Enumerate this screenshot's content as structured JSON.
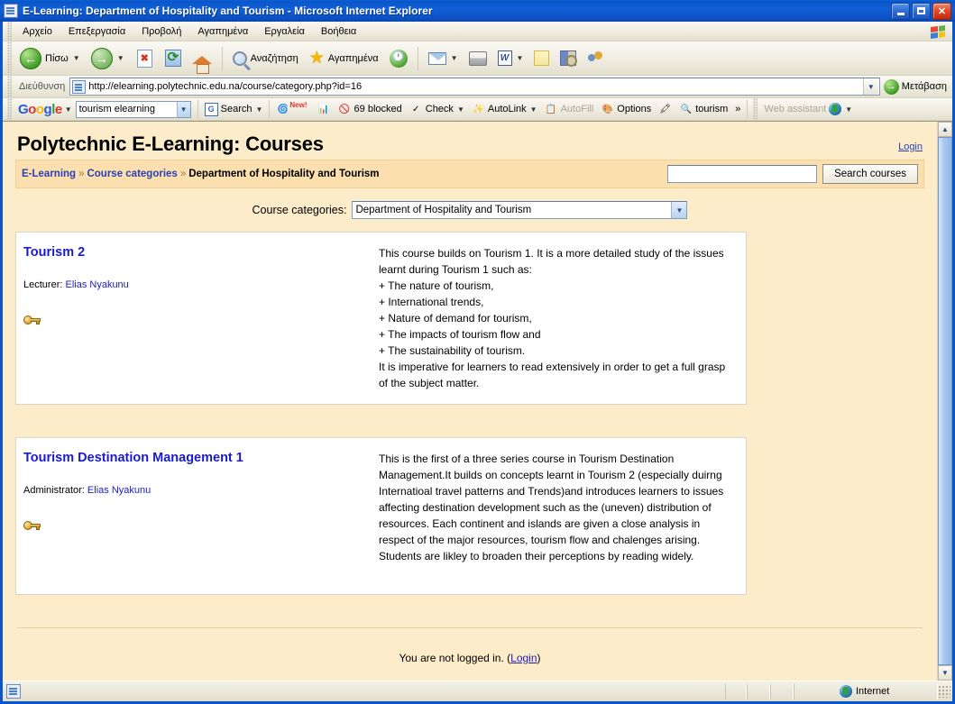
{
  "window": {
    "title": "E-Learning: Department of Hospitality and Tourism - Microsoft Internet Explorer",
    "minimize_label": "",
    "maximize_label": "",
    "close_label": "✕"
  },
  "menubar": {
    "items": [
      {
        "label": "Αρχείο"
      },
      {
        "label": "Επεξεργασία"
      },
      {
        "label": "Προβολή"
      },
      {
        "label": "Αγαπημένα"
      },
      {
        "label": "Εργαλεία"
      },
      {
        "label": "Βοήθεια"
      }
    ]
  },
  "toolbar": {
    "back_label": "Πίσω",
    "forward_label": "",
    "stop_label": "",
    "refresh_label": "",
    "home_label": "",
    "search_label": "Αναζήτηση",
    "favorites_label": "Αγαπημένα",
    "history_label": "",
    "mail_label": "",
    "print_label": "",
    "edit_word_label": "",
    "notes_label": "",
    "research_label": "",
    "messenger_label": ""
  },
  "addressbar": {
    "label": "Διεύθυνση",
    "url": "http://elearning.polytechnic.edu.na/course/category.php?id=16",
    "go_label": "Μετάβαση"
  },
  "google_toolbar": {
    "logo": "Google",
    "query": "tourism elearning",
    "search_label": "Search",
    "new_badge": "New!",
    "blocked_label": "69 blocked",
    "check_label": "Check",
    "autolink_label": "AutoLink",
    "autofill_label": "AutoFill",
    "options_label": "Options",
    "highlight_term": "tourism",
    "more_label": "»",
    "web_assistant_label": "Web assistant"
  },
  "page": {
    "site_title": "Polytechnic E-Learning: Courses",
    "login_link": "Login",
    "breadcrumb": {
      "items": [
        {
          "label": "E-Learning",
          "link": true
        },
        {
          "label": "Course categories",
          "link": true
        },
        {
          "label": "Department of Hospitality and Tourism",
          "link": false
        }
      ],
      "separator": "»"
    },
    "course_search": {
      "value": "",
      "placeholder": "",
      "button_label": "Search courses"
    },
    "category_selector": {
      "label": "Course categories:",
      "selected": "Department of Hospitality and Tourism"
    },
    "courses": [
      {
        "name": "Tourism 2",
        "role_label": "Lecturer:",
        "teacher": "Elias Nyakunu",
        "enrolment_key_icon": "key-icon",
        "summary": "This course builds on Tourism 1. It is a more detailed study of the issues learnt during Tourism 1 such as:\n+ The nature of tourism,\n+ International trends,\n+ Nature of demand for tourism,\n+ The impacts of tourism flow and\n+ The sustainability of tourism.\nIt is imperative for learners to read extensively in order to get a full grasp of the subject matter."
      },
      {
        "name": "Tourism Destination Management 1",
        "role_label": "Administrator:",
        "teacher": "Elias Nyakunu",
        "enrolment_key_icon": "key-icon",
        "summary": "This is the first of a three series course in Tourism Destination Management.It builds on concepts learnt in Tourism 2 (especially duirng Internatioal travel patterns and Trends)and introduces learners to issues affecting destination development such as the (uneven) distribution of resources. Each continent and islands are given a close analysis in respect of the major resources, tourism flow and chalenges arising. Students are likley to broaden their perceptions by reading widely."
      }
    ],
    "footer": {
      "not_logged_in": "You are not logged in. (",
      "login_link": "Login",
      "close_paren": ")"
    }
  },
  "statusbar": {
    "message": "",
    "zone": "Internet"
  },
  "colors": {
    "page_bg": "#fcecc9",
    "navbar_bg": "#fbdfae",
    "link": "#1a1aca",
    "course_box_bg": "#ffffff",
    "titlebar_blue": "#0a56c9"
  }
}
